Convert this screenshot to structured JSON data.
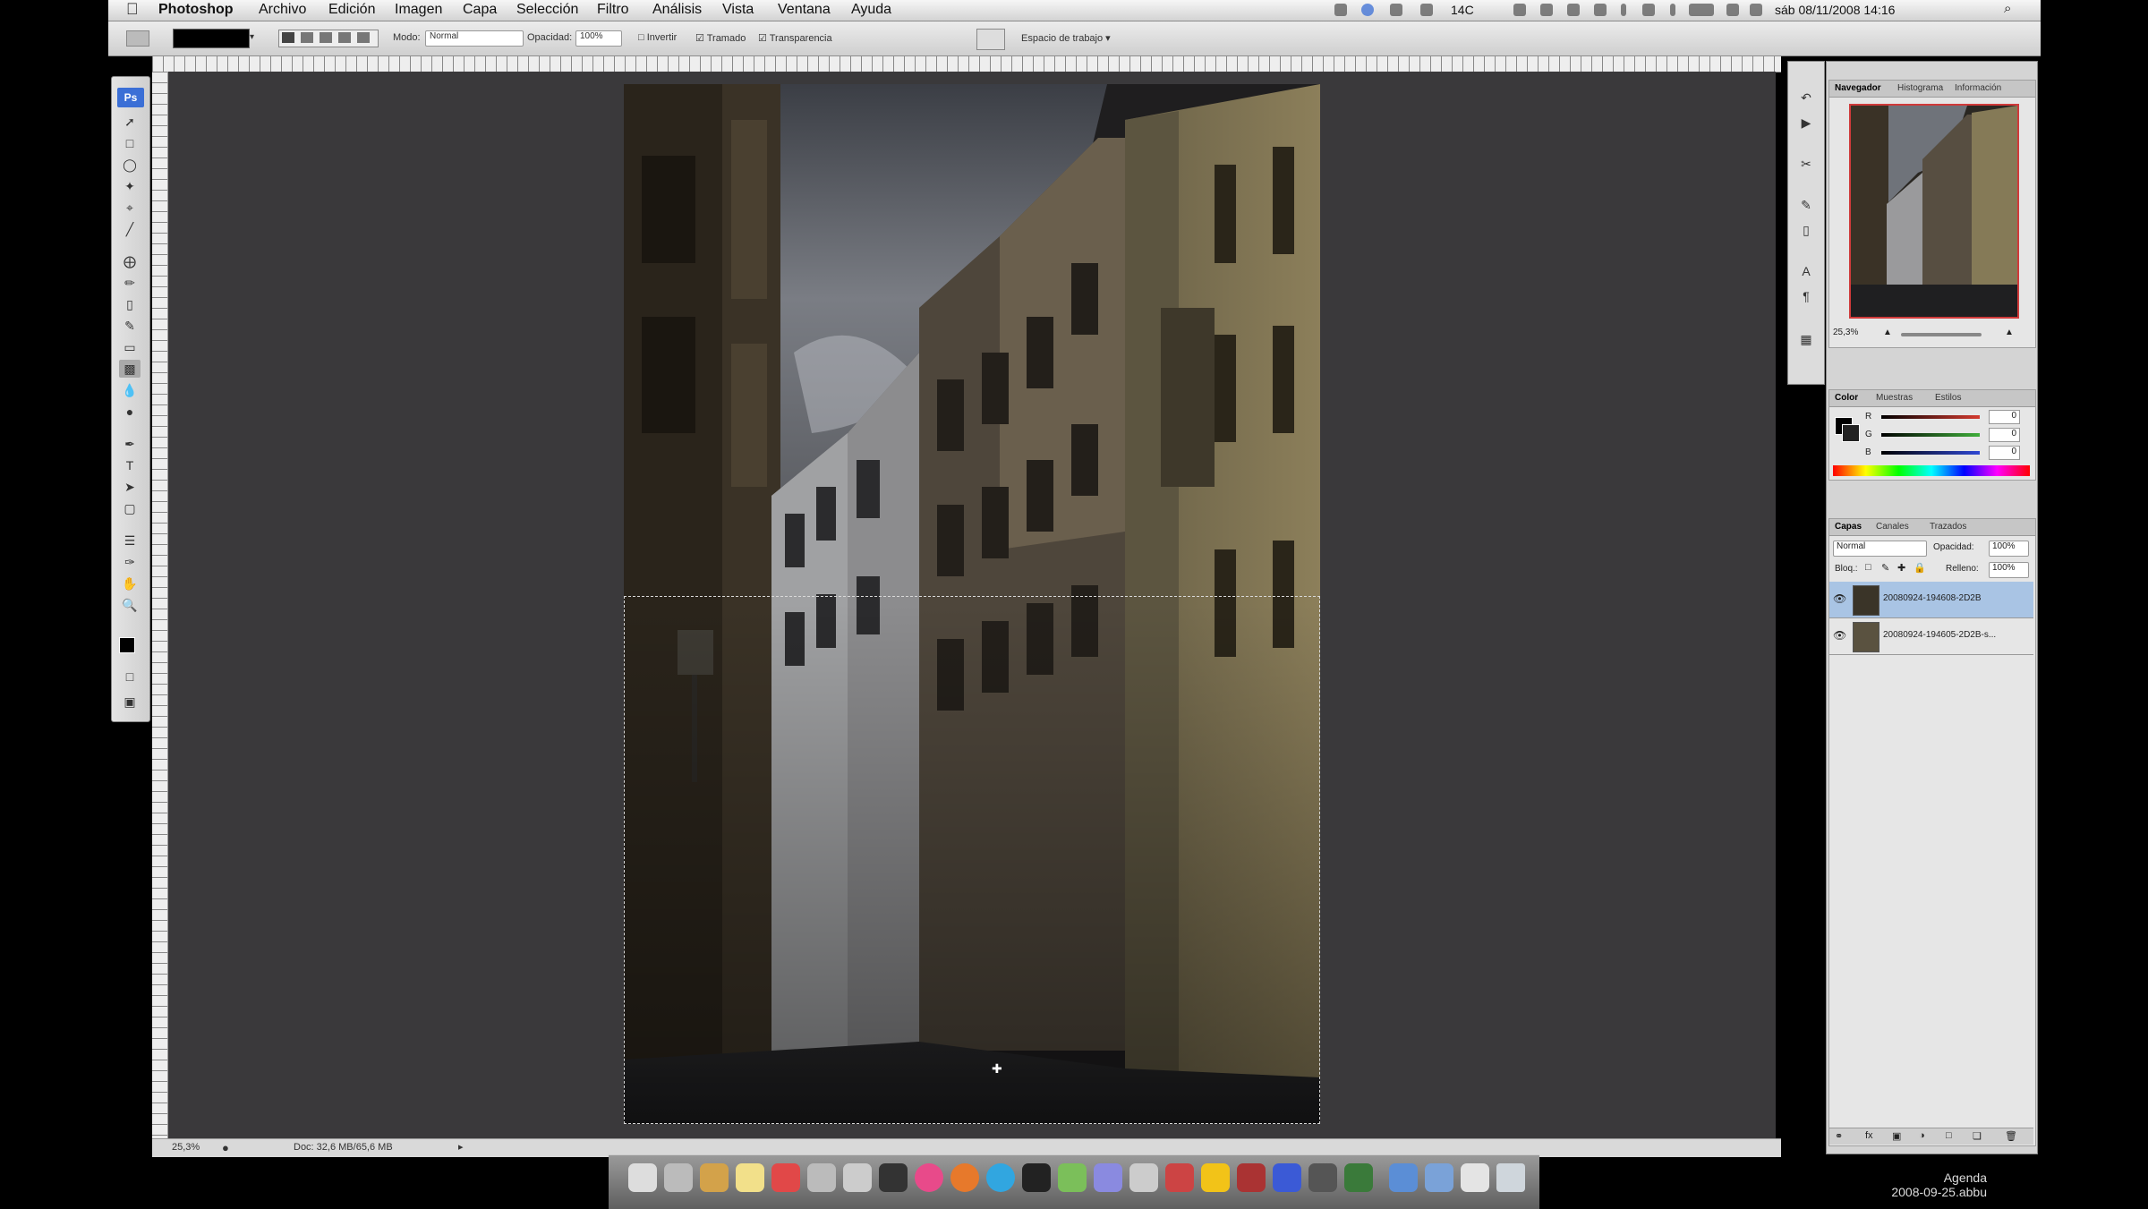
{
  "menubar": {
    "app_name": "Photoshop",
    "items": [
      "Archivo",
      "Edición",
      "Imagen",
      "Capa",
      "Selección",
      "Filtro",
      "Análisis",
      "Vista",
      "Ventana",
      "Ayuda"
    ],
    "status": {
      "temperature": "14C",
      "datetime": "sáb 08/11/2008 14:16"
    }
  },
  "options_bar": {
    "mode_label": "Modo:",
    "mode_value": "Normal",
    "opacity_label": "Opacidad:",
    "opacity_value": "100%",
    "invert_label": "Invertir",
    "dither_label": "Tramado",
    "transparency_label": "Transparencia",
    "workspace_label": "Espacio de trabajo"
  },
  "status_bar": {
    "zoom": "25,3%",
    "doc_info": "Doc: 32,6 MB/65,6 MB"
  },
  "navigator": {
    "tabs": [
      "Navegador",
      "Histograma",
      "Información"
    ],
    "active_tab": "Navegador",
    "zoom": "25,3%"
  },
  "color_panel": {
    "tabs": [
      "Color",
      "Muestras",
      "Estilos"
    ],
    "active_tab": "Color",
    "channels": [
      {
        "label": "R",
        "value": "0",
        "color": "#d43a2f"
      },
      {
        "label": "G",
        "value": "0",
        "color": "#3fae3a"
      },
      {
        "label": "B",
        "value": "0",
        "color": "#2f48d4"
      }
    ]
  },
  "layers_panel": {
    "tabs": [
      "Capas",
      "Canales",
      "Trazados"
    ],
    "active_tab": "Capas",
    "blend_mode": "Normal",
    "opacity_label": "Opacidad:",
    "opacity_value": "100%",
    "lock_label": "Bloq.:",
    "fill_label": "Relleno:",
    "fill_value": "100%",
    "layers": [
      {
        "name": "20080924-194608-2D2B",
        "selected": true
      },
      {
        "name": "20080924-194605-2D2B-s...",
        "selected": false
      }
    ]
  },
  "desktop": {
    "agenda_title": "Agenda",
    "agenda_file": "2008-09-25.abbu"
  },
  "colors": {
    "canvas_bg": "#3a393b",
    "selection": "#ffffff",
    "accent_blue": "#3b6fd6"
  }
}
